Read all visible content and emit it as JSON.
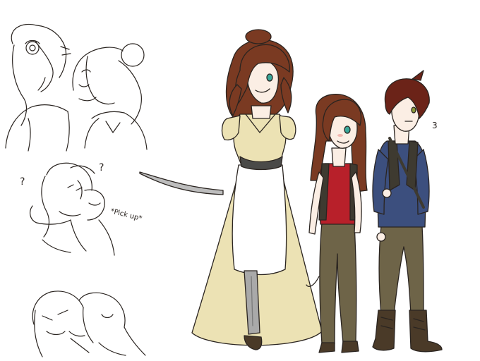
{
  "artwork": {
    "sketch_annotations": {
      "question_mark": "?",
      "pick_up_label": "*Pick up*",
      "confusion_mark": "3"
    },
    "palette": {
      "line": "#2a2420",
      "hair_brown": "#7a3a22",
      "hair_dark_red": "#6b2318",
      "dress": "#ece2b4",
      "apron": "#ffffff",
      "belt": "#4a4a48",
      "shirt_red": "#b8202a",
      "sweater_blue": "#3c4f7e",
      "pants_olive": "#6e6448",
      "boots": "#4a3a28",
      "vest": "#3e3a30",
      "skin": "#fbeee4",
      "eyes_teal": "#3aa89a",
      "prosthetic_gray": "#a9a9a9"
    },
    "figures": [
      {
        "name": "tall-woman-in-yellow-dress",
        "hair": "hair_brown",
        "outfit": "dress"
      },
      {
        "name": "girl-in-red-shirt",
        "hair": "hair_brown",
        "outfit": "shirt_red"
      },
      {
        "name": "boy-in-blue-sweater",
        "hair": "hair_dark_red",
        "outfit": "sweater_blue"
      }
    ]
  }
}
